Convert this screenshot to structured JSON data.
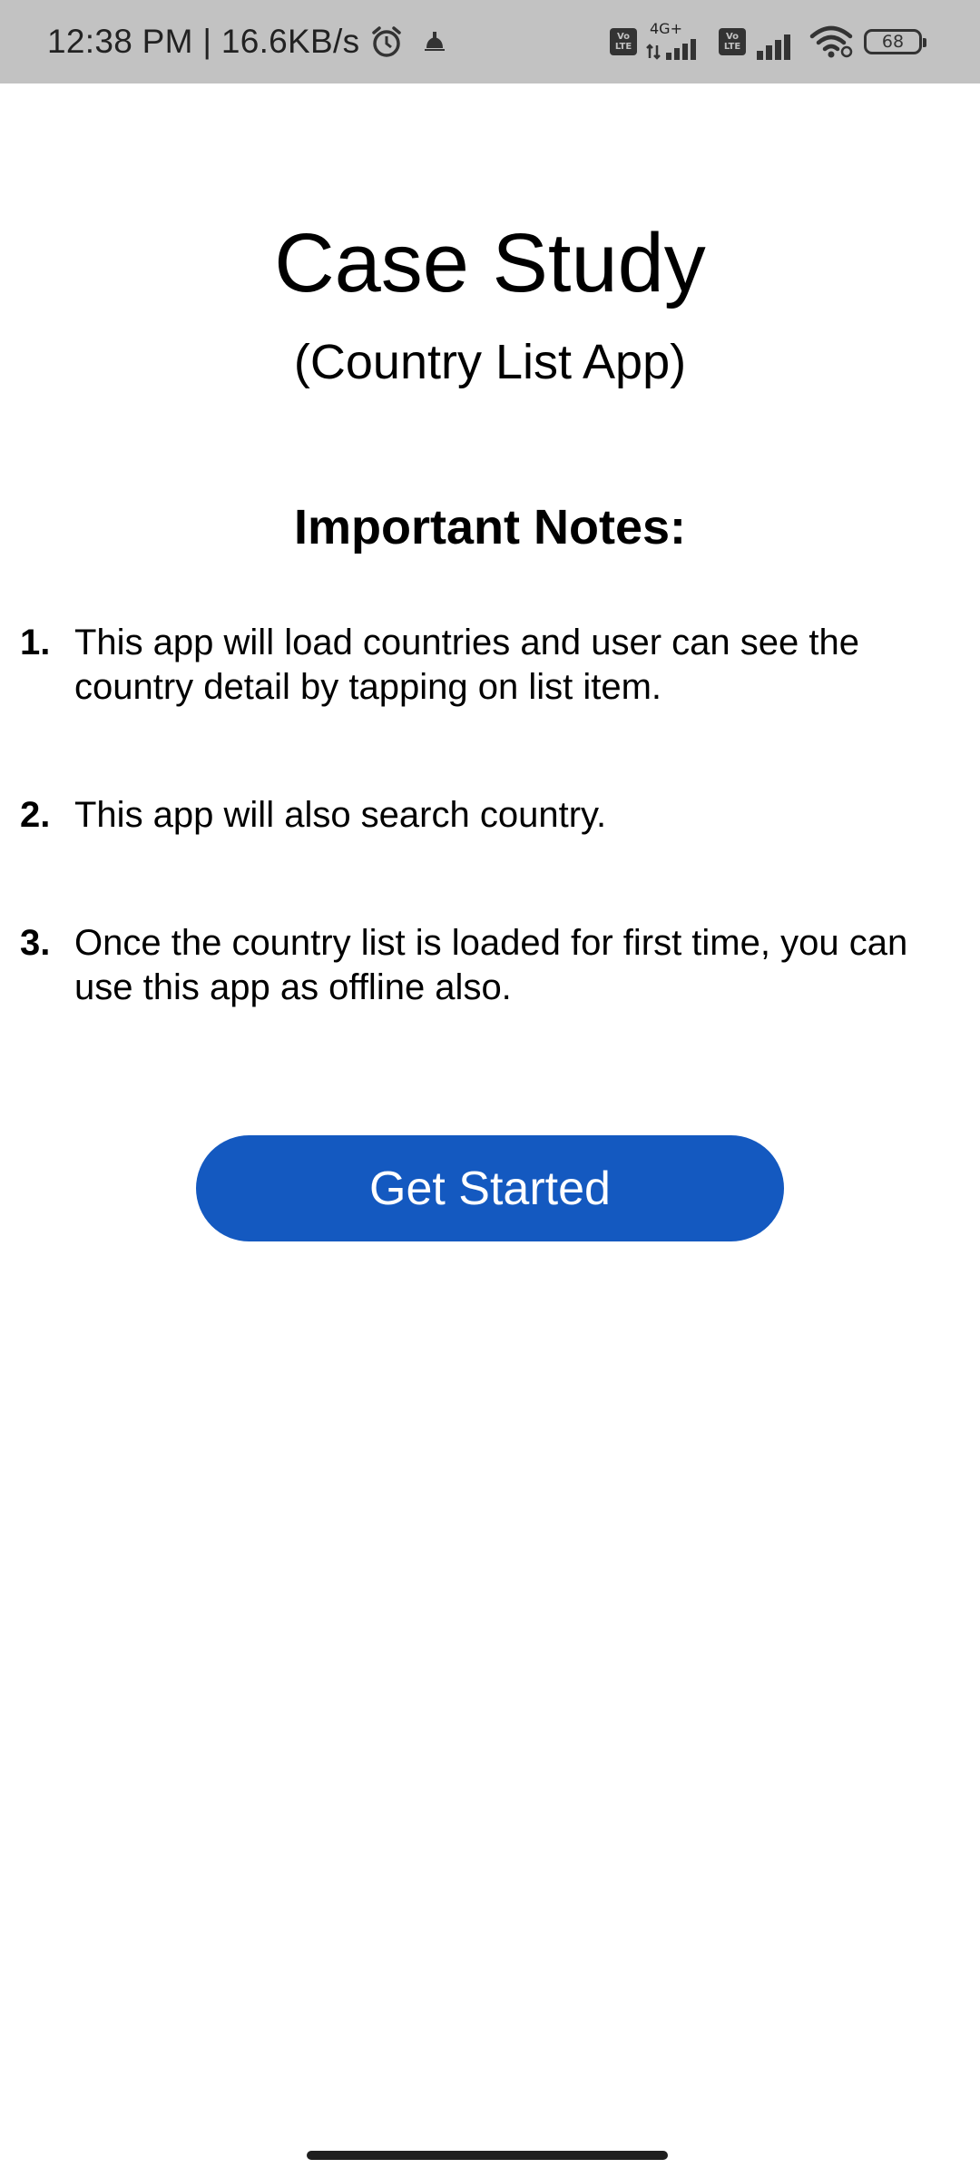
{
  "status_bar": {
    "time_speed": "12:38 PM | 16.6KB/s",
    "volte_label": "Vo LTE",
    "network_type": "4G+",
    "battery_level": "68",
    "icons": [
      "alarm-icon",
      "notification-icon",
      "volte-icon",
      "signal-icon",
      "volte-icon",
      "signal-icon",
      "wifi-icon",
      "battery-icon"
    ]
  },
  "main": {
    "title": "Case Study",
    "subtitle": "(Country List App)",
    "notes_heading": "Important Notes:",
    "notes": [
      {
        "number": "1.",
        "text": "This app will load countries and user can see the country detail by tapping on list item."
      },
      {
        "number": "2.",
        "text": "This app will also search country."
      },
      {
        "number": "3.",
        "text": "Once the country list is loaded for first time, you can use this app as offline also."
      }
    ],
    "button_label": "Get Started"
  },
  "colors": {
    "status_bar_bg": "#c2c2c2",
    "button_bg": "#1459c0",
    "button_text": "#ffffff",
    "background": "#ffffff"
  }
}
